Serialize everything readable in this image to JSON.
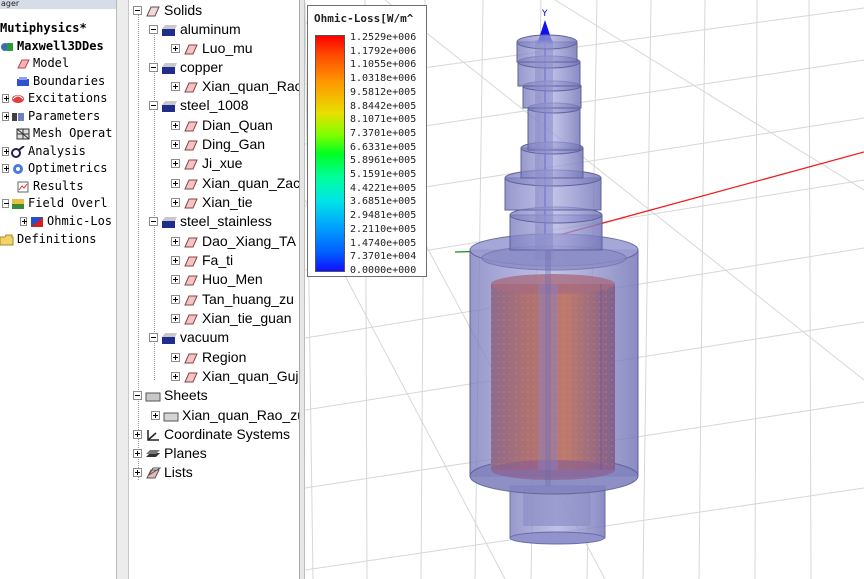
{
  "project_manager": {
    "header": "ager",
    "project": "Mutiphysics*",
    "design": "Maxwell3DDes",
    "items": [
      "Model",
      "Boundaries",
      "Excitations",
      "Parameters",
      "Mesh Operat",
      "Analysis",
      "Optimetrics",
      "Results",
      "Field Overl"
    ],
    "overlay_child": "Ohmic-Los",
    "definitions": "Definitions"
  },
  "model_tree": {
    "solids": "Solids",
    "aluminum": "aluminum",
    "aluminum_items": [
      "Luo_mu"
    ],
    "copper": "copper",
    "copper_items": [
      "Xian_quan_Rao"
    ],
    "steel_1008": "steel_1008",
    "steel_1008_items": [
      "Dian_Quan",
      "Ding_Gan",
      "Ji_xue",
      "Xian_quan_Zac",
      "Xian_tie"
    ],
    "steel_stainless": "steel_stainless",
    "steel_stainless_items": [
      "Dao_Xiang_TA",
      "Fa_ti",
      "Huo_Men",
      "Tan_huang_zu",
      "Xian_tie_guan"
    ],
    "vacuum": "vacuum",
    "vacuum_items": [
      "Region",
      "Xian_quan_Guj"
    ],
    "sheets": "Sheets",
    "sheets_items": [
      "Xian_quan_Rao_zu"
    ],
    "coordinate_systems": "Coordinate Systems",
    "planes": "Planes",
    "lists": "Lists"
  },
  "legend": {
    "title": "Ohmic-Loss[W/m^",
    "values": [
      "1.2529e+006",
      "1.1792e+006",
      "1.1055e+006",
      "1.0318e+006",
      "9.5812e+005",
      "8.8442e+005",
      "8.1071e+005",
      "7.3701e+005",
      "6.6331e+005",
      "5.8961e+005",
      "5.1591e+005",
      "4.4221e+005",
      "3.6851e+005",
      "2.9481e+005",
      "2.2110e+005",
      "1.4740e+005",
      "7.3701e+004",
      "0.0000e+000"
    ],
    "colors": [
      "#ff0000",
      "#ff9a00",
      "#e6e000",
      "#00ff20",
      "#00e6e6",
      "#009cff",
      "#1010ff"
    ]
  },
  "viewport": {
    "axis_label": "Y",
    "axis_colors": {
      "y": "#0000ff",
      "x": "#ff0000",
      "z": "#00a000"
    }
  }
}
